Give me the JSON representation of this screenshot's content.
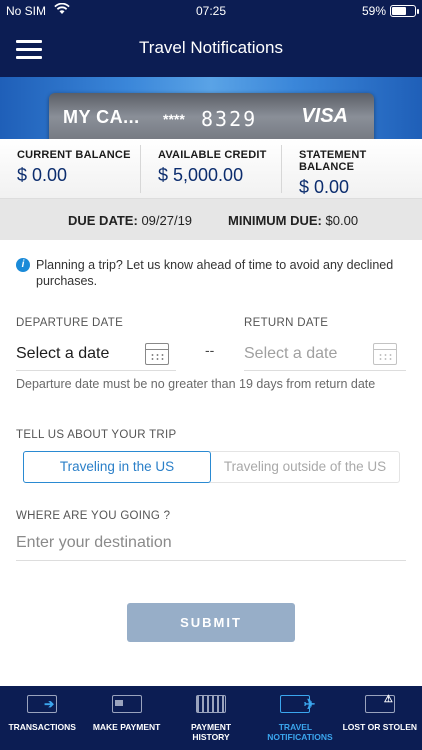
{
  "status": {
    "carrier": "No SIM",
    "time": "07:25",
    "battery": "59%"
  },
  "header": {
    "title": "Travel Notifications"
  },
  "card": {
    "name": "MY CA...",
    "mask": "****",
    "last4": "8329",
    "network": "VISA"
  },
  "balances": [
    {
      "label": "CURRENT BALANCE",
      "value": "$ 0.00"
    },
    {
      "label": "AVAILABLE CREDIT",
      "value": "$ 5,000.00"
    },
    {
      "label": "STATEMENT BALANCE",
      "value": "$ 0.00"
    }
  ],
  "due": {
    "due_label": "DUE DATE:",
    "due_value": "09/27/19",
    "min_label": "MINIMUM DUE:",
    "min_value": "$0.00"
  },
  "info": {
    "text": "Planning a trip? Let us know ahead of time to avoid any declined purchases."
  },
  "dates": {
    "departure_label": "DEPARTURE DATE",
    "departure_value": "Select a date",
    "separator": "--",
    "return_label": "RETURN DATE",
    "return_value": "Select a date",
    "hint": "Departure date must be no greater than 19 days from return date"
  },
  "trip": {
    "label": "TELL US ABOUT YOUR TRIP",
    "options": [
      "Traveling in the US",
      "Traveling outside of the US"
    ],
    "selected": "Traveling in the US"
  },
  "destination": {
    "label": "WHERE ARE YOU GOING ?",
    "placeholder": "Enter your destination"
  },
  "submit": {
    "label": "SUBMIT"
  },
  "tabbar": {
    "items": [
      {
        "label": "TRANSACTIONS",
        "icon": "transactions-icon"
      },
      {
        "label": "MAKE PAYMENT",
        "icon": "payment-icon"
      },
      {
        "label": "PAYMENT HISTORY",
        "icon": "history-icon"
      },
      {
        "label": "TRAVEL NOTIFICATIONS",
        "icon": "travel-icon",
        "active": true
      },
      {
        "label": "LOST OR STOLEN",
        "icon": "alert-icon"
      }
    ]
  },
  "colors": {
    "primary": "#0c1d53",
    "accent": "#2a8ad2",
    "submit": "#97aec8"
  }
}
